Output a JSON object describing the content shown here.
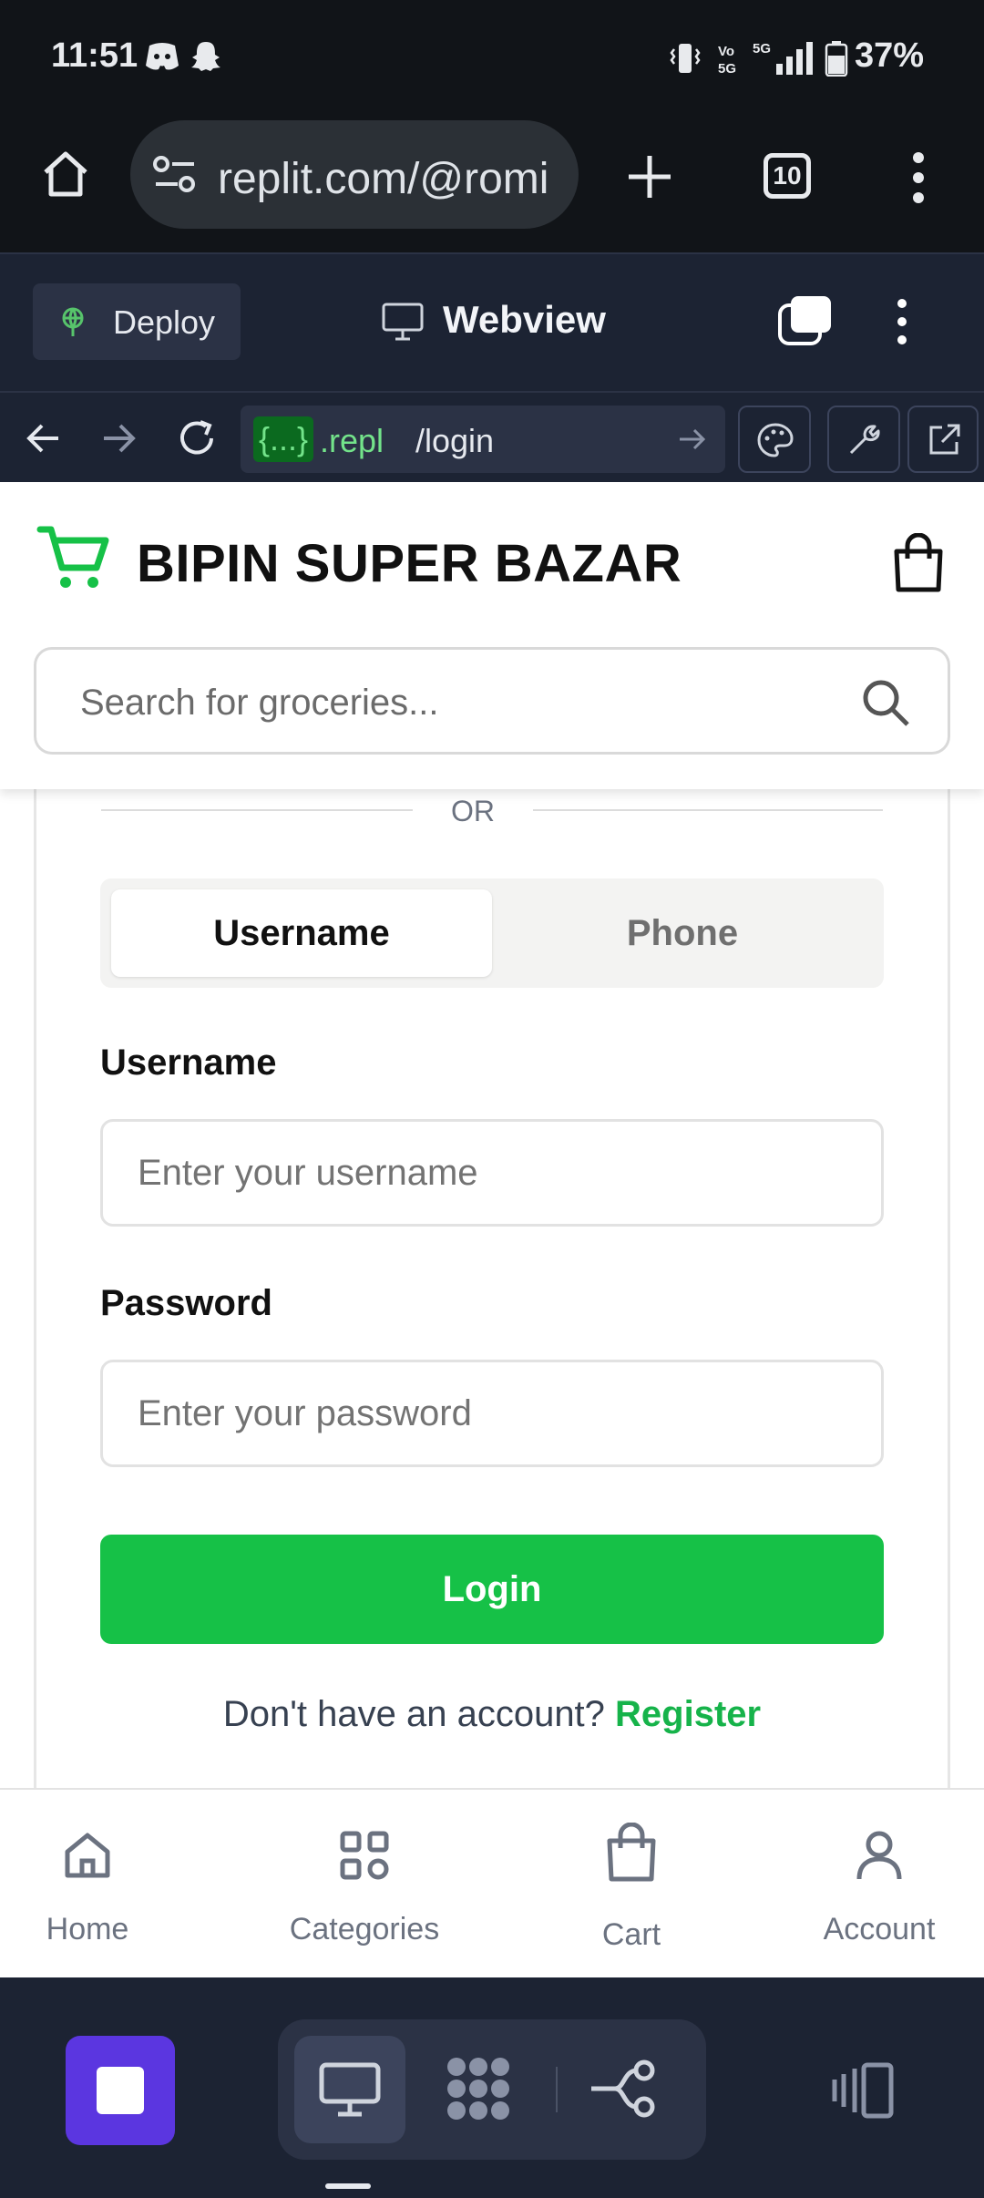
{
  "status_bar": {
    "time": "11:51",
    "battery": "37%",
    "network": "5G"
  },
  "browser": {
    "url": "replit.com/@romi",
    "tab_count": "10"
  },
  "replit": {
    "deploy_label": "Deploy",
    "webview_title": "Webview",
    "repl_badge": "{...}",
    "repl_domain": ".repl",
    "path": "/login"
  },
  "app": {
    "store_name": "BIPIN SUPER BAZAR",
    "search_placeholder": "Search for groceries...",
    "or_label": "OR",
    "tabs": {
      "username": "Username",
      "phone": "Phone"
    },
    "username_label": "Username",
    "username_placeholder": "Enter your username",
    "password_label": "Password",
    "password_placeholder": "Enter your password",
    "login_label": "Login",
    "register_prompt": "Don't have an account?",
    "register_link": "Register",
    "accent_color": "#16c147"
  },
  "bottom_nav": {
    "home": "Home",
    "categories": "Categories",
    "cart": "Cart",
    "account": "Account"
  }
}
